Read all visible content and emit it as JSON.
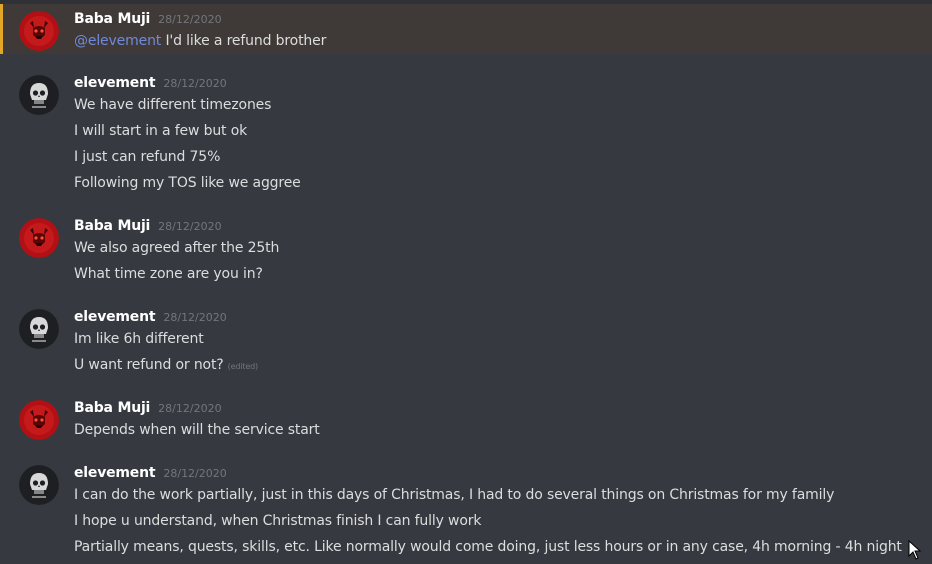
{
  "messages": [
    {
      "author": "Baba Muji",
      "timestamp": "28/12/2020",
      "avatar_icon": "red-demon-avatar-icon",
      "mention": "@elevement",
      "lines": [
        "I'd like a refund brother"
      ]
    },
    {
      "author": "elevement",
      "timestamp": "28/12/2020",
      "avatar_icon": "skull-avatar-icon",
      "lines": [
        "We have different timezones",
        "I will start in a few but ok",
        "I just can refund 75%",
        "Following my TOS like we aggree"
      ]
    },
    {
      "author": "Baba Muji",
      "timestamp": "28/12/2020",
      "avatar_icon": "red-demon-avatar-icon",
      "lines": [
        "We also agreed after the 25th",
        "What time zone are you in?"
      ]
    },
    {
      "author": "elevement",
      "timestamp": "28/12/2020",
      "avatar_icon": "skull-avatar-icon",
      "lines": [
        "Im like 6h different",
        "U want refund or not?"
      ],
      "edited_label": "(edited)"
    },
    {
      "author": "Baba Muji",
      "timestamp": "28/12/2020",
      "avatar_icon": "red-demon-avatar-icon",
      "lines": [
        "Depends when will the service start"
      ]
    },
    {
      "author": "elevement",
      "timestamp": "28/12/2020",
      "avatar_icon": "skull-avatar-icon",
      "lines": [
        "I can do the work partially, just in this days of Christmas, I had to do several things on Christmas for my family",
        "I hope u understand, when Christmas finish I can fully work",
        "Partially means, quests, skills, etc. Like normally would come doing, just less hours or in any case, 4h morning - 4h night"
      ]
    }
  ],
  "colors": {
    "background": "#36393f",
    "highlight_background": "#3f3a37",
    "highlight_bar": "#e3a727",
    "author": "#ffffff",
    "text": "#dcddde",
    "timestamp": "#72767d",
    "mention": "#7289da"
  }
}
